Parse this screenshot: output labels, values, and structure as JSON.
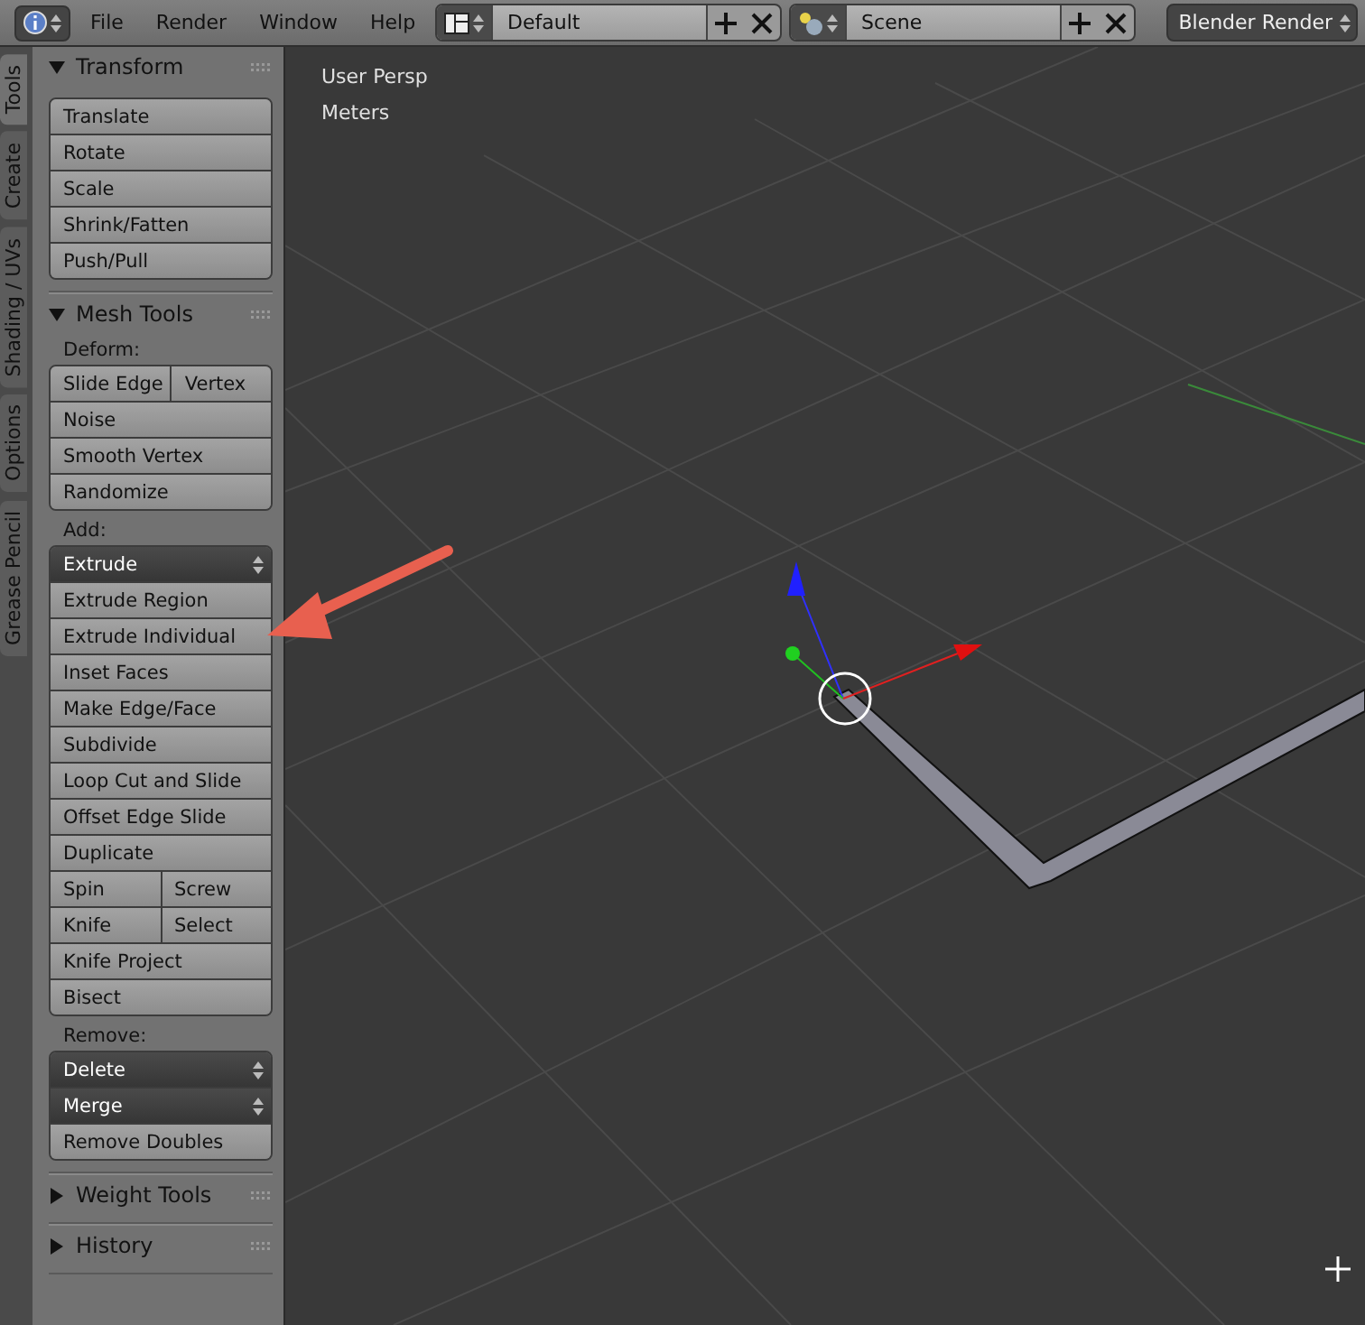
{
  "header": {
    "menus": [
      "File",
      "Render",
      "Window",
      "Help"
    ],
    "screen_layout": {
      "value": "Default"
    },
    "scene": {
      "value": "Scene"
    },
    "render_engine": {
      "value": "Blender Render"
    }
  },
  "side_tabs": [
    {
      "label": "Tools",
      "selected": true
    },
    {
      "label": "Create",
      "selected": false
    },
    {
      "label": "Shading / UVs",
      "selected": false
    },
    {
      "label": "Options",
      "selected": false
    },
    {
      "label": "Grease Pencil",
      "selected": false
    }
  ],
  "panels": [
    {
      "title": "Transform",
      "expanded": true,
      "sections": [
        {
          "rows": [
            [
              {
                "label": "Translate",
                "kind": "button"
              }
            ],
            [
              {
                "label": "Rotate",
                "kind": "button"
              }
            ],
            [
              {
                "label": "Scale",
                "kind": "button"
              }
            ],
            [
              {
                "label": "Shrink/Fatten",
                "kind": "button"
              }
            ],
            [
              {
                "label": "Push/Pull",
                "kind": "button"
              }
            ]
          ]
        }
      ]
    },
    {
      "title": "Mesh Tools",
      "expanded": true,
      "sections": [
        {
          "label": "Deform:",
          "rows": [
            [
              {
                "label": "Slide Edge",
                "kind": "button"
              },
              {
                "label": "Vertex",
                "kind": "button"
              }
            ],
            [
              {
                "label": "Noise",
                "kind": "button"
              }
            ],
            [
              {
                "label": "Smooth Vertex",
                "kind": "button"
              }
            ],
            [
              {
                "label": "Randomize",
                "kind": "button"
              }
            ]
          ]
        },
        {
          "label": "Add:",
          "rows": [
            [
              {
                "label": "Extrude",
                "kind": "dropdown"
              }
            ],
            [
              {
                "label": "Extrude Region",
                "kind": "button"
              }
            ],
            [
              {
                "label": "Extrude Individual",
                "kind": "button"
              }
            ],
            [
              {
                "label": "Inset Faces",
                "kind": "button"
              }
            ],
            [
              {
                "label": "Make Edge/Face",
                "kind": "button"
              }
            ],
            [
              {
                "label": "Subdivide",
                "kind": "button"
              }
            ],
            [
              {
                "label": "Loop Cut and Slide",
                "kind": "button"
              }
            ],
            [
              {
                "label": "Offset Edge Slide",
                "kind": "button"
              }
            ],
            [
              {
                "label": "Duplicate",
                "kind": "button"
              }
            ],
            [
              {
                "label": "Spin",
                "kind": "button"
              },
              {
                "label": "Screw",
                "kind": "button"
              }
            ],
            [
              {
                "label": "Knife",
                "kind": "button"
              },
              {
                "label": "Select",
                "kind": "button"
              }
            ],
            [
              {
                "label": "Knife Project",
                "kind": "button"
              }
            ],
            [
              {
                "label": "Bisect",
                "kind": "button"
              }
            ]
          ]
        },
        {
          "label": "Remove:",
          "rows": [
            [
              {
                "label": "Delete",
                "kind": "dropdown"
              }
            ],
            [
              {
                "label": "Merge",
                "kind": "dropdown"
              }
            ],
            [
              {
                "label": "Remove Doubles",
                "kind": "button"
              }
            ]
          ]
        }
      ]
    },
    {
      "title": "Weight Tools",
      "expanded": false
    },
    {
      "title": "History",
      "expanded": false
    }
  ],
  "viewport": {
    "labels": [
      "User Persp",
      "Meters"
    ]
  }
}
